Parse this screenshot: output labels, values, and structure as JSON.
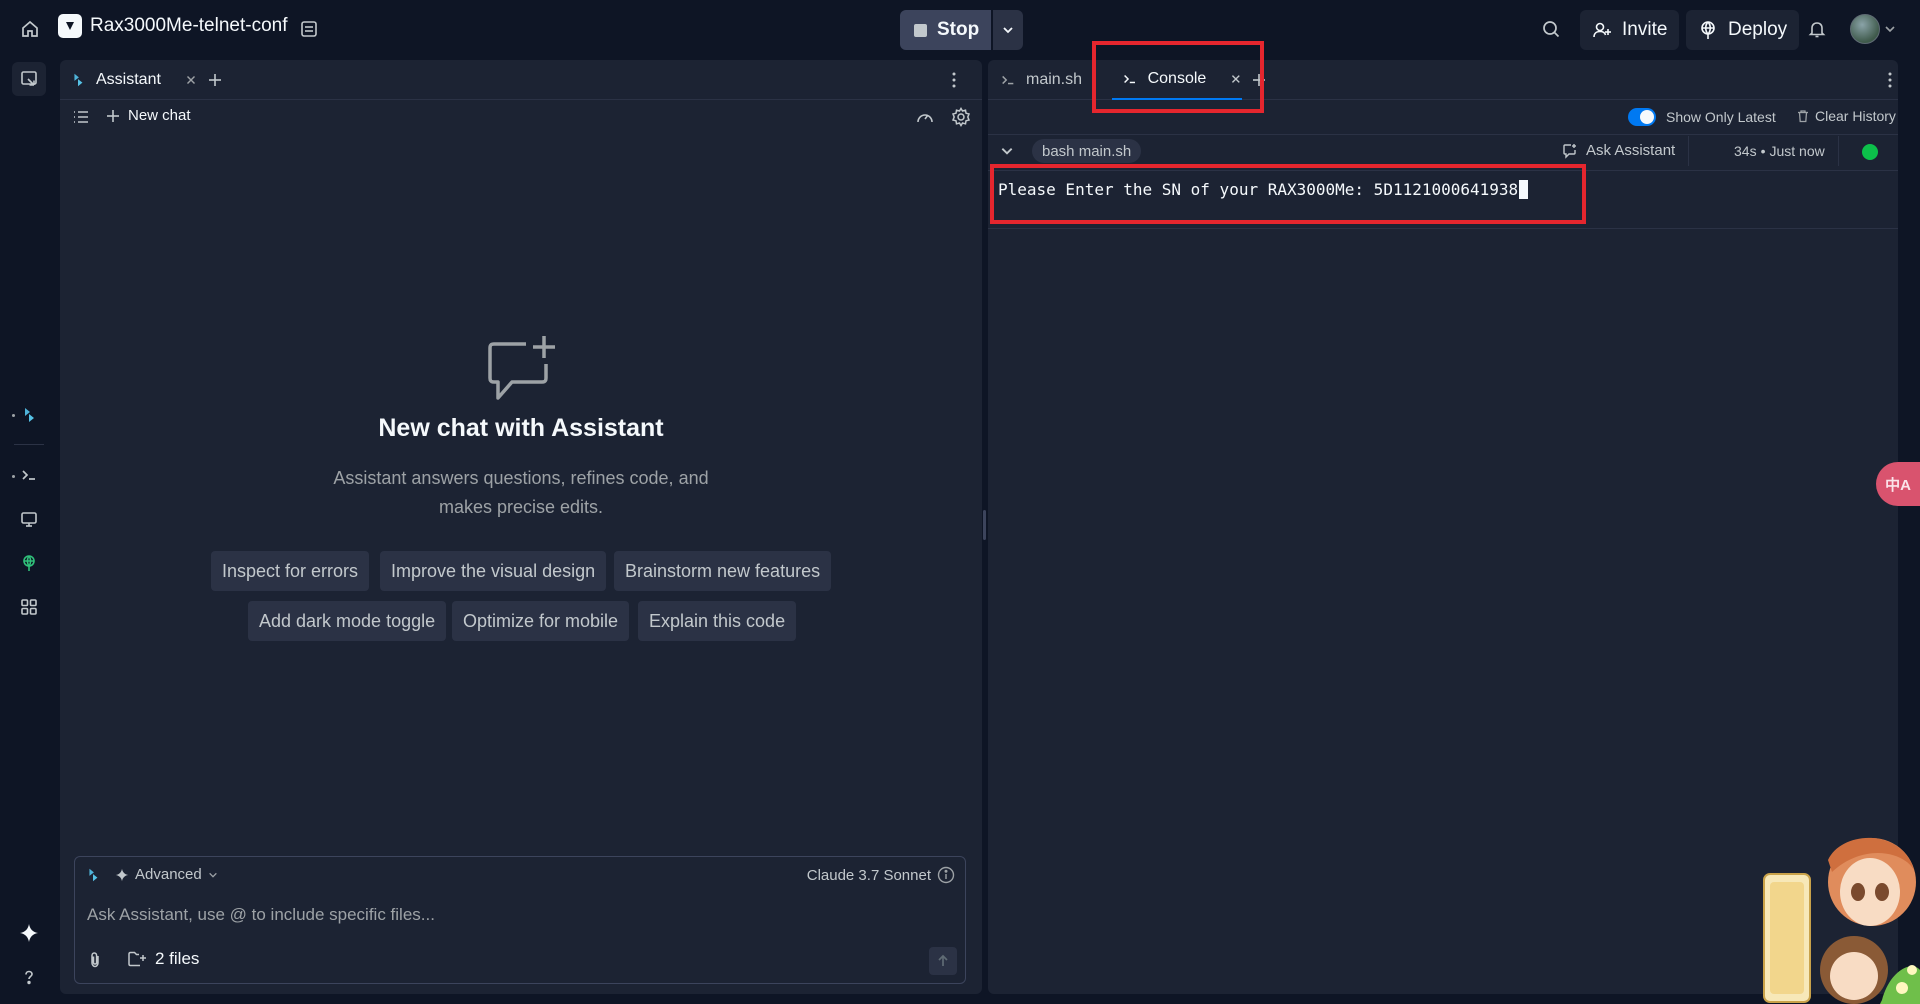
{
  "colors": {
    "background": "#0e1525",
    "panel": "#1c2333",
    "accent": "#0079f2",
    "status_green": "#0cc04a",
    "highlight_red": "#e5262e"
  },
  "topbar": {
    "home_icon": "home-icon",
    "repl_name": "Rax3000Me-telnet-conf",
    "stop_label": "Stop",
    "invite_label": "Invite",
    "deploy_label": "Deploy"
  },
  "left_panel": {
    "tab_label": "Assistant",
    "new_chat_label": "New chat",
    "empty_title": "New chat with Assistant",
    "empty_desc_line1": "Assistant answers questions, refines code, and",
    "empty_desc_line2": "makes precise edits.",
    "suggestions": [
      "Inspect for errors",
      "Improve the visual design",
      "Brainstorm new features",
      "Add dark mode toggle",
      "Optimize for mobile",
      "Explain this code"
    ],
    "composer": {
      "mode_label": "Advanced",
      "model_label": "Claude 3.7 Sonnet",
      "placeholder": "Ask Assistant, use @ to include specific files...",
      "files_label": "2 files"
    }
  },
  "right_panel": {
    "tabs": [
      {
        "label": "main.sh",
        "active": false
      },
      {
        "label": "Console",
        "active": true
      }
    ],
    "show_only_latest_label": "Show Only Latest",
    "show_only_latest": true,
    "clear_history_label": "Clear History",
    "run": {
      "command": "bash main.sh",
      "ask_assistant_label": "Ask Assistant",
      "duration": "34s",
      "separator": "•",
      "time": "Just now"
    },
    "output": "Please Enter the SN of your RAX3000Me: 5D1121000641938"
  },
  "floating": {
    "translate_label": "中A"
  }
}
